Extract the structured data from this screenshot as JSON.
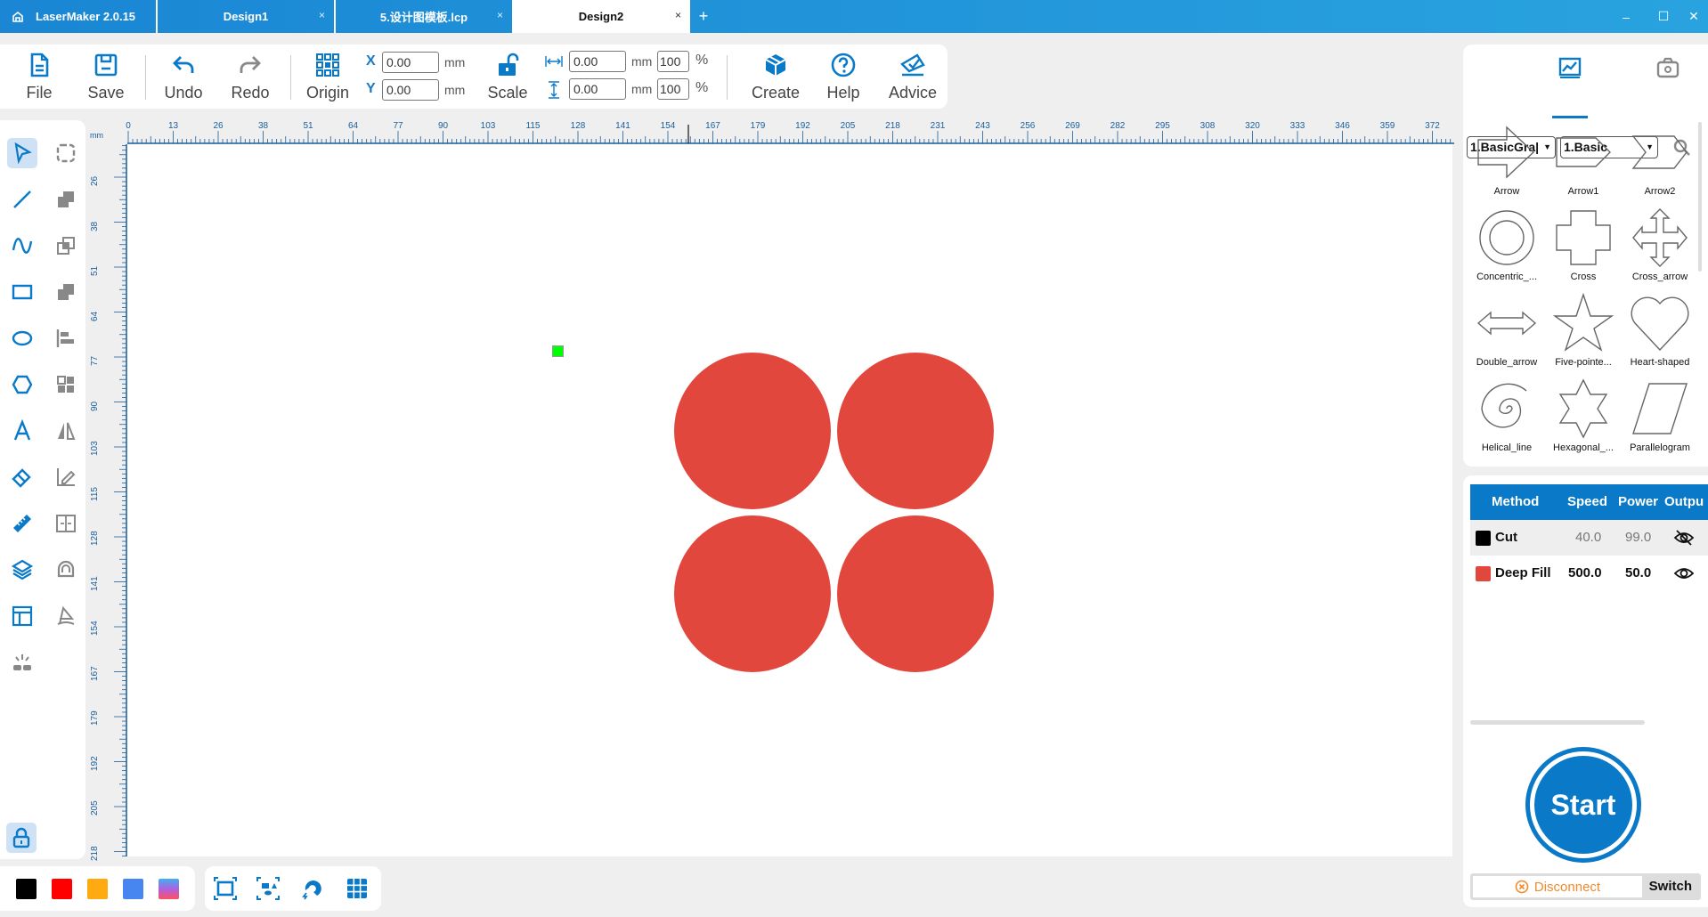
{
  "titlebar": {
    "app_title": "LaserMaker 2.0.15",
    "tabs": [
      {
        "label": "Design1",
        "active": false
      },
      {
        "label": "5.设计图模板.lcp",
        "active": false
      },
      {
        "label": "Design2",
        "active": true
      }
    ],
    "close_glyph": "×",
    "add_glyph": "+",
    "minimize_glyph": "–",
    "maximize_glyph": "☐",
    "window_close_glyph": "✕"
  },
  "toolbar": {
    "file": "File",
    "save": "Save",
    "undo": "Undo",
    "redo": "Redo",
    "origin": "Origin",
    "scale": "Scale",
    "create": "Create",
    "help": "Help",
    "advice": "Advice",
    "x_label": "X",
    "y_label": "Y",
    "x_value": "0.00",
    "y_value": "0.00",
    "width_value": "0.00",
    "height_value": "0.00",
    "width_pct": "100",
    "height_pct": "100",
    "unit": "mm",
    "pct_unit": "%"
  },
  "left_tools": [
    {
      "name": "select-tool",
      "icon": "pointer-icon",
      "selected": true
    },
    {
      "name": "node-edit-tool",
      "icon": "dashed-rect-icon"
    },
    {
      "name": "line-tool",
      "icon": "line-icon"
    },
    {
      "name": "union-tool",
      "icon": "union-icon"
    },
    {
      "name": "curve-tool",
      "icon": "curve-icon"
    },
    {
      "name": "intersect-tool",
      "icon": "intersect-icon"
    },
    {
      "name": "rectangle-tool",
      "icon": "rectangle-icon"
    },
    {
      "name": "subtract-tool",
      "icon": "subtract-icon"
    },
    {
      "name": "ellipse-tool",
      "icon": "ellipse-icon"
    },
    {
      "name": "align-tool",
      "icon": "align-left-icon"
    },
    {
      "name": "polygon-tool",
      "icon": "hexagon-icon"
    },
    {
      "name": "array-tool",
      "icon": "grid-icon"
    },
    {
      "name": "text-tool",
      "icon": "text-icon"
    },
    {
      "name": "mirror-tool",
      "icon": "mirror-icon"
    },
    {
      "name": "eraser-tool",
      "icon": "eraser-icon"
    },
    {
      "name": "edit-path-tool",
      "icon": "pen-edit-icon"
    },
    {
      "name": "measure-tool",
      "icon": "ruler-icon"
    },
    {
      "name": "distribute-tool",
      "icon": "distribute-icon"
    },
    {
      "name": "layers-tool",
      "icon": "layers-icon"
    },
    {
      "name": "outline-tool",
      "icon": "outline-icon"
    },
    {
      "name": "layout-tool",
      "icon": "layout-icon"
    },
    {
      "name": "trace-tool",
      "icon": "trace-icon"
    },
    {
      "name": "light-tool",
      "icon": "burst-icon"
    },
    {
      "name": "lock-tool",
      "icon": "lock-icon",
      "selected": true
    }
  ],
  "ruler": {
    "unit": "mm",
    "top_labels": [
      "0",
      "13",
      "26",
      "38",
      "51",
      "64",
      "77",
      "90",
      "103",
      "115",
      "128",
      "141",
      "154",
      "167",
      "179",
      "192",
      "205",
      "218",
      "231",
      "243",
      "256",
      "269",
      "282",
      "295",
      "308",
      "320",
      "333",
      "346",
      "359",
      "372"
    ],
    "left_labels": [
      "26",
      "38",
      "51",
      "64",
      "77",
      "90",
      "103",
      "115",
      "128",
      "141",
      "154",
      "167",
      "179",
      "192",
      "205",
      "218"
    ]
  },
  "canvas": {
    "shapes": [
      {
        "type": "circle",
        "color": "#e2473d",
        "layer": "Deep Fill"
      },
      {
        "type": "circle",
        "color": "#e2473d",
        "layer": "Deep Fill"
      },
      {
        "type": "circle",
        "color": "#e2473d",
        "layer": "Deep Fill"
      },
      {
        "type": "circle",
        "color": "#e2473d",
        "layer": "Deep Fill"
      }
    ],
    "laser_marker_color": "#00ff00"
  },
  "color_swatches": [
    "#000000",
    "#ff0000",
    "#ffaa11",
    "#4785f0",
    "gradient"
  ],
  "view_buttons": [
    "fit-view-icon",
    "select-all-view-icon",
    "magnet-icon",
    "grid-icon"
  ],
  "shape_library": {
    "category": "1.BasicGra|",
    "subcategory": "1.Basic",
    "items": [
      {
        "label": "Arrow"
      },
      {
        "label": "Arrow1"
      },
      {
        "label": "Arrow2"
      },
      {
        "label": "Concentric_..."
      },
      {
        "label": "Cross"
      },
      {
        "label": "Cross_arrow"
      },
      {
        "label": "Double_arrow"
      },
      {
        "label": "Five-pointe..."
      },
      {
        "label": "Heart-shaped"
      },
      {
        "label": "Helical_line"
      },
      {
        "label": "Hexagonal_..."
      },
      {
        "label": "Parallelogram"
      }
    ]
  },
  "layers": {
    "headers": [
      "Method",
      "Speed",
      "Power",
      "Outpu"
    ],
    "rows": [
      {
        "color": "#000000",
        "method": "Cut",
        "speed": "40.0",
        "power": "99.0",
        "output": "hidden"
      },
      {
        "color": "#e2473d",
        "method": "Deep Fill",
        "speed": "500.0",
        "power": "50.0",
        "output": "visible"
      }
    ]
  },
  "controls": {
    "start": "Start",
    "disconnect": "Disconnect",
    "switch": "Switch"
  },
  "colors": {
    "accent": "#0a7ac8",
    "titlebar": "#1a86d4",
    "disconnect": "#f08a2c"
  }
}
